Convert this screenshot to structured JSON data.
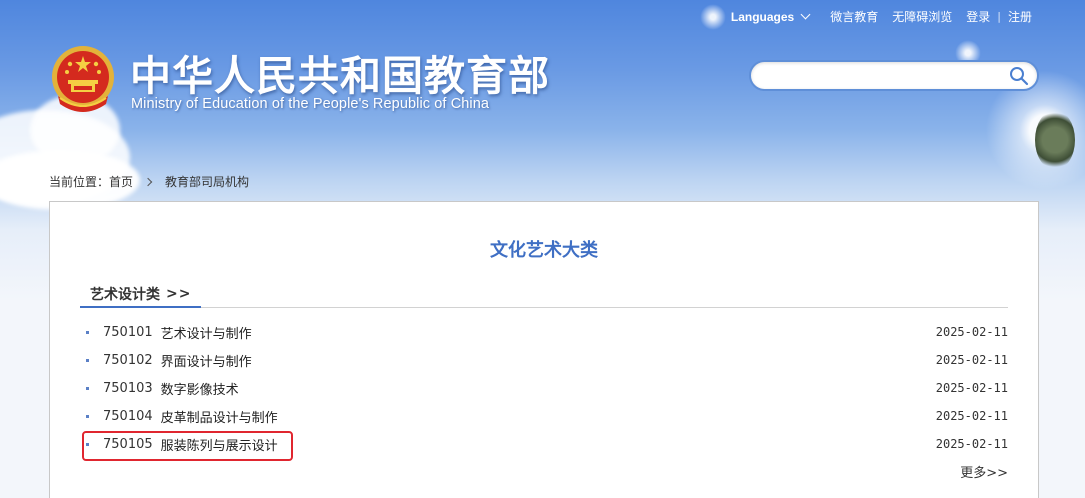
{
  "topnav": {
    "languages_label": "Languages",
    "links": [
      "微言教育",
      "无障碍浏览",
      "登录",
      "注册"
    ],
    "separator": "|"
  },
  "header": {
    "title_cn": "中华人民共和国教育部",
    "title_en": "Ministry of Education of the People's Republic of China"
  },
  "search": {
    "placeholder": "",
    "value": ""
  },
  "breadcrumb": {
    "label": "当前位置：",
    "items": [
      "首页",
      "教育部司局机构"
    ]
  },
  "page": {
    "title": "文化艺术大类",
    "section_title": "艺术设计类",
    "section_more_symbol": ">>",
    "more_link": "更多>>"
  },
  "list": [
    {
      "code": "750101",
      "name": "艺术设计与制作",
      "date": "2025-02-11"
    },
    {
      "code": "750102",
      "name": "界面设计与制作",
      "date": "2025-02-11"
    },
    {
      "code": "750103",
      "name": "数字影像技术",
      "date": "2025-02-11"
    },
    {
      "code": "750104",
      "name": "皮革制品设计与制作",
      "date": "2025-02-11"
    },
    {
      "code": "750105",
      "name": "服装陈列与展示设计",
      "date": "2025-02-11",
      "highlighted": true
    }
  ],
  "colors": {
    "accent": "#3f6fc4",
    "highlight_box": "#e0262f",
    "header_bg": "#4f86de"
  },
  "icons": {
    "search": "search-icon",
    "emblem": "national-emblem-icon",
    "dropdown": "chevron-down-icon",
    "breadcrumb_sep": "chevron-right-icon"
  }
}
